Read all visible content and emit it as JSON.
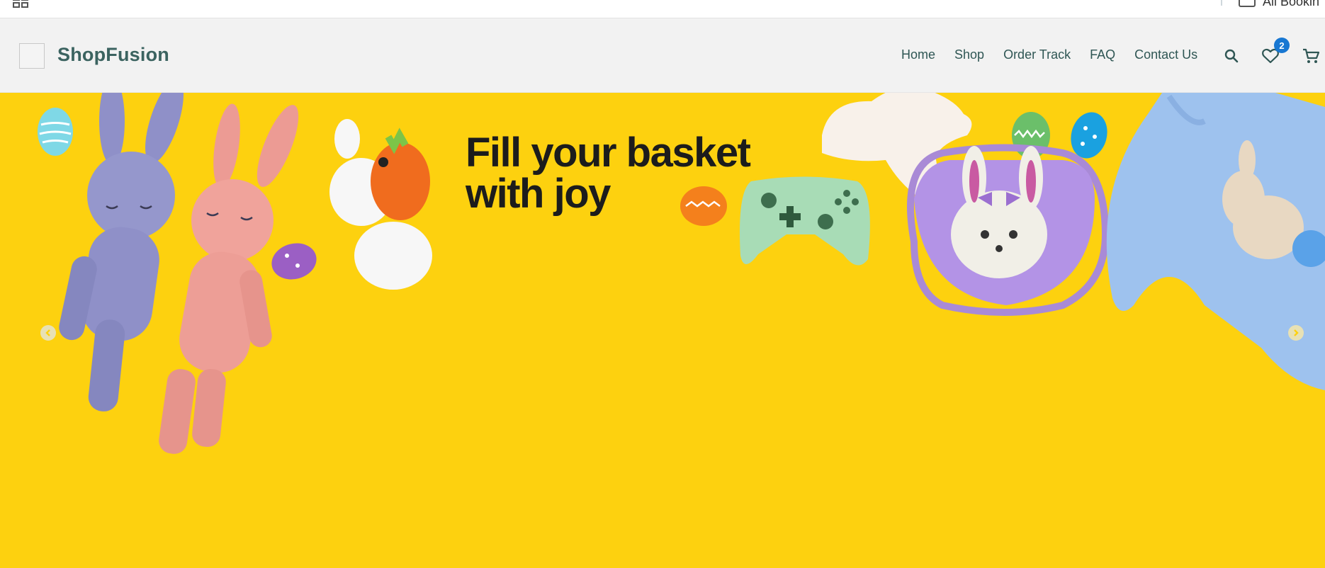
{
  "top_bar": {
    "grid_icon": "grid-icon",
    "account_label": "All Bookin"
  },
  "header": {
    "brand": "ShopFusion",
    "nav": [
      {
        "label": "Home"
      },
      {
        "label": "Shop"
      },
      {
        "label": "Order Track"
      },
      {
        "label": "FAQ"
      },
      {
        "label": "Contact Us"
      }
    ],
    "wishlist_count": "2",
    "icons": [
      "search-icon",
      "heart-icon",
      "cart-icon"
    ]
  },
  "hero": {
    "headline_line1": "Fill your basket",
    "headline_line2": "with joy",
    "background": "#fdd10f",
    "arrows": [
      "chevron-left-icon",
      "chevron-right-icon"
    ]
  },
  "colors": {
    "brand": "#3b6360",
    "badge": "#1877d2",
    "hero_bg": "#fdd10f"
  }
}
